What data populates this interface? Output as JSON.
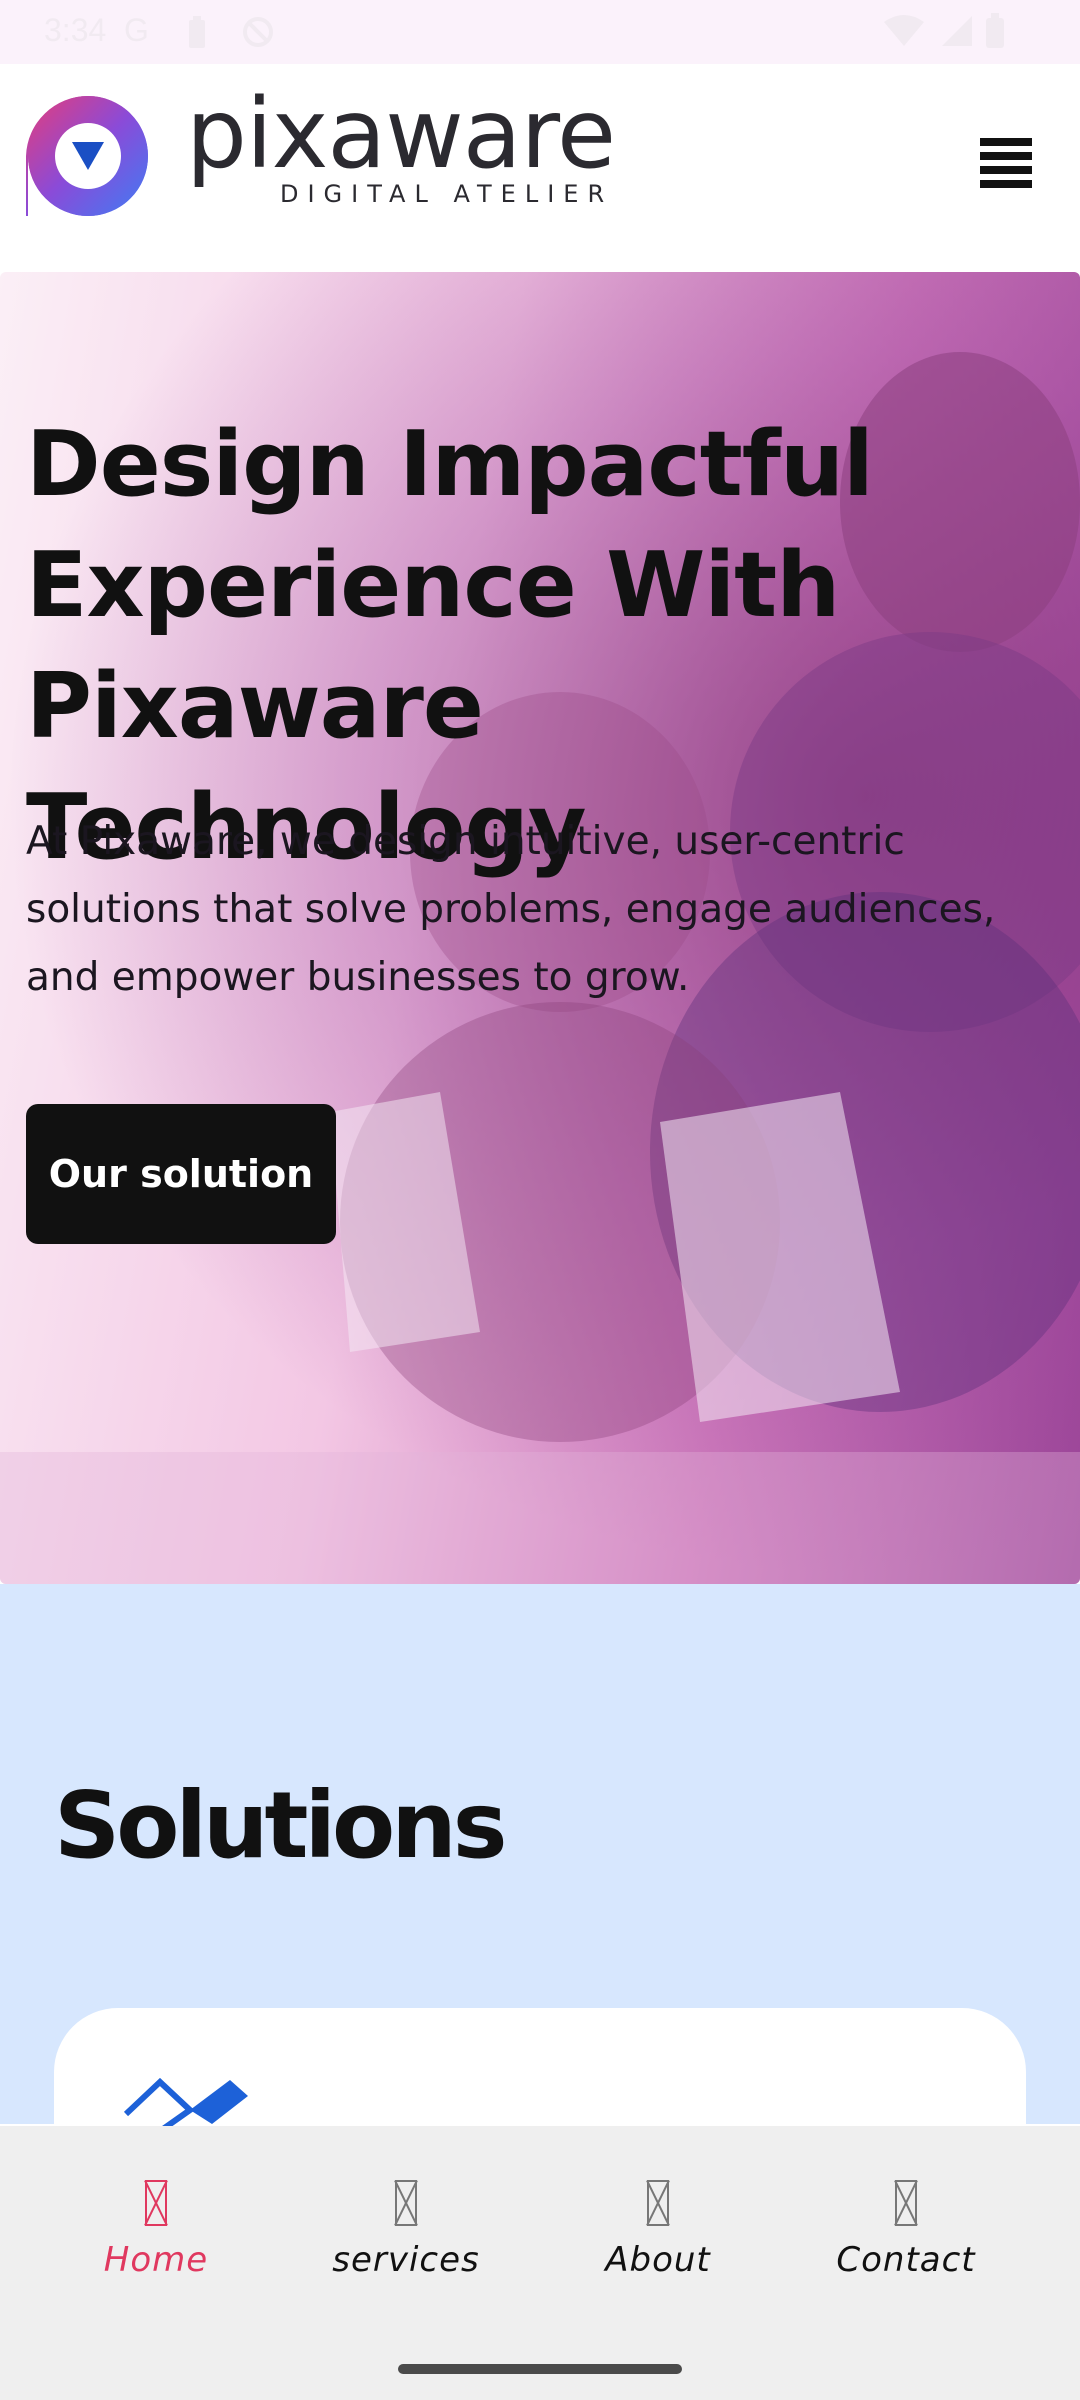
{
  "status_bar": {
    "time": "3:34",
    "carrier": "G",
    "icons": [
      "battery-saver-icon",
      "dnd-icon",
      "wifi-icon",
      "signal-icon",
      "battery-icon"
    ]
  },
  "header": {
    "brand_name": "pixaware",
    "brand_tagline": "DIGITAL ATELIER",
    "logo_icon": "play-logo-icon",
    "menu_icon": "hamburger-menu-icon"
  },
  "hero": {
    "title": "Design Impactful Experience With Pixaware Technology",
    "subtitle": "At Pixaware, we design intuitive, user-centric solutions that solve problems, engage audiences, and empower businesses to grow.",
    "cta_label": "Our solution"
  },
  "solutions": {
    "title": "Solutions",
    "first_card_icon": "design-tools-icon"
  },
  "bottom_nav": {
    "items": [
      {
        "label": "Home",
        "icon": "missing-glyph-icon",
        "active": true
      },
      {
        "label": "services",
        "icon": "missing-glyph-icon",
        "active": false
      },
      {
        "label": "About",
        "icon": "missing-glyph-icon",
        "active": false
      },
      {
        "label": "Contact",
        "icon": "missing-glyph-icon",
        "active": false
      }
    ]
  },
  "colors": {
    "status_bar_bg": "#fbf2fb",
    "hero_accent": "#cf7cbd",
    "solutions_bg": "#d7e7fe",
    "nav_active": "#e0385f",
    "cta_bg": "#111111"
  }
}
